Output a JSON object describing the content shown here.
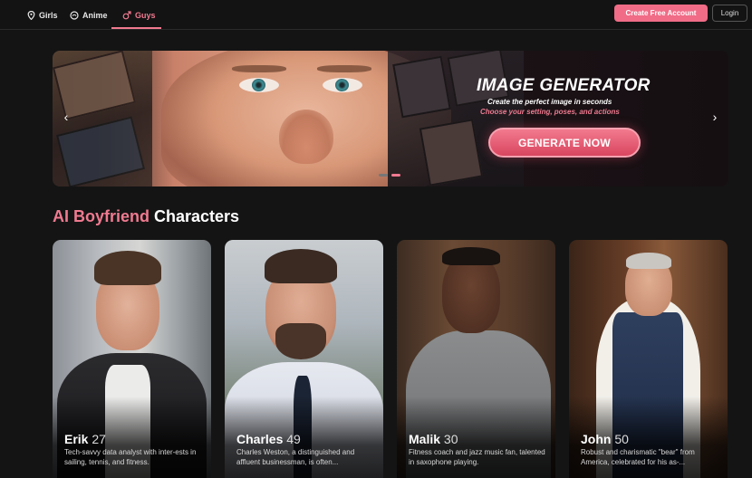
{
  "nav": {
    "items": [
      {
        "label": "Girls",
        "icon": "location-pin-icon"
      },
      {
        "label": "Anime",
        "icon": "anime-icon"
      },
      {
        "label": "Guys",
        "icon": "male-icon",
        "active": true
      }
    ],
    "create_account_label": "Create Free Account",
    "login_label": "Login"
  },
  "banner": {
    "title": "IMAGE GENERATOR",
    "subtitle": "Create the perfect image in seconds",
    "tagline": "Choose your setting, poses, and actions",
    "cta_label": "GENERATE NOW",
    "prev_icon": "‹",
    "next_icon": "›"
  },
  "section": {
    "title_highlight": "AI Boyfriend",
    "title_rest": " Characters"
  },
  "characters": [
    {
      "name": "Erik",
      "age": "27",
      "description": "Tech-savvy data analyst with inter-ests in sailing, tennis, and fitness."
    },
    {
      "name": "Charles",
      "age": "49",
      "description": "Charles Weston, a distinguished and affluent businessman, is often..."
    },
    {
      "name": "Malik",
      "age": "30",
      "description": "Fitness coach and jazz music fan, talented in saxophone playing."
    },
    {
      "name": "John",
      "age": "50",
      "description": "Robust and charismatic \"bear\" from America, celebrated for his as-..."
    }
  ],
  "colors": {
    "accent": "#f07a90",
    "background": "#141414"
  }
}
